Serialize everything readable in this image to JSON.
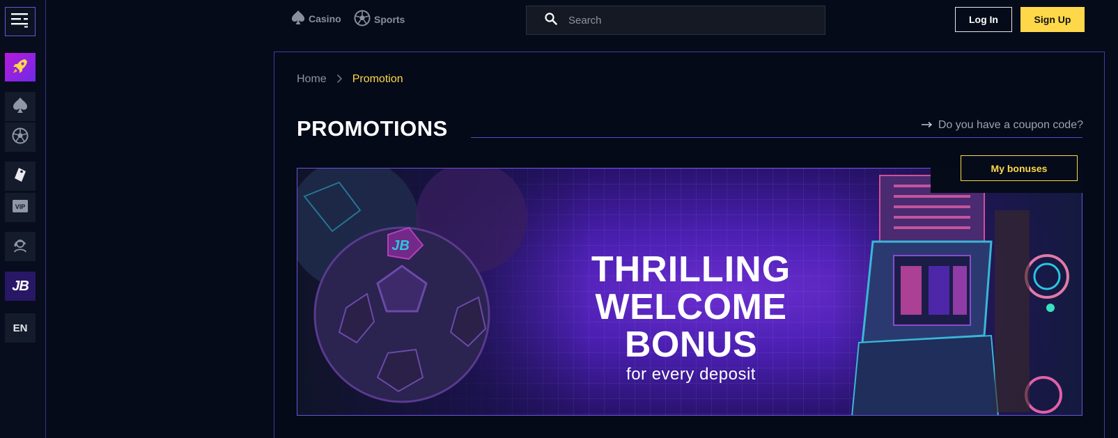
{
  "sidebar": {
    "menu_icon": "menu-icon",
    "items": [
      {
        "name": "rocket",
        "icon": "rocket-icon"
      },
      {
        "name": "casino",
        "icon": "spade-icon"
      },
      {
        "name": "sports",
        "icon": "soccer-ball-icon"
      },
      {
        "name": "promotions",
        "icon": "tag-icon"
      },
      {
        "name": "vip",
        "icon": "vip-icon",
        "label": "VIP"
      },
      {
        "name": "support",
        "icon": "support-agent-icon"
      },
      {
        "name": "jb",
        "icon": "jb-logo-icon",
        "label": "JB"
      }
    ],
    "language": "EN"
  },
  "topnav": {
    "casino_label": "Casino",
    "sports_label": "Sports",
    "search_placeholder": "Search",
    "login_label": "Log In",
    "signup_label": "Sign Up"
  },
  "breadcrumb": {
    "home": "Home",
    "current": "Promotion"
  },
  "page": {
    "title": "PROMOTIONS",
    "coupon_link": "Do you have a coupon code?",
    "my_bonuses_label": "My bonuses"
  },
  "banner": {
    "line1": "THRILLING",
    "line2": "WELCOME BONUS",
    "subtitle": "for every deposit"
  },
  "colors": {
    "accent_yellow": "#ffd84a",
    "border_purple": "#4a38a6",
    "background": "#050b19"
  }
}
